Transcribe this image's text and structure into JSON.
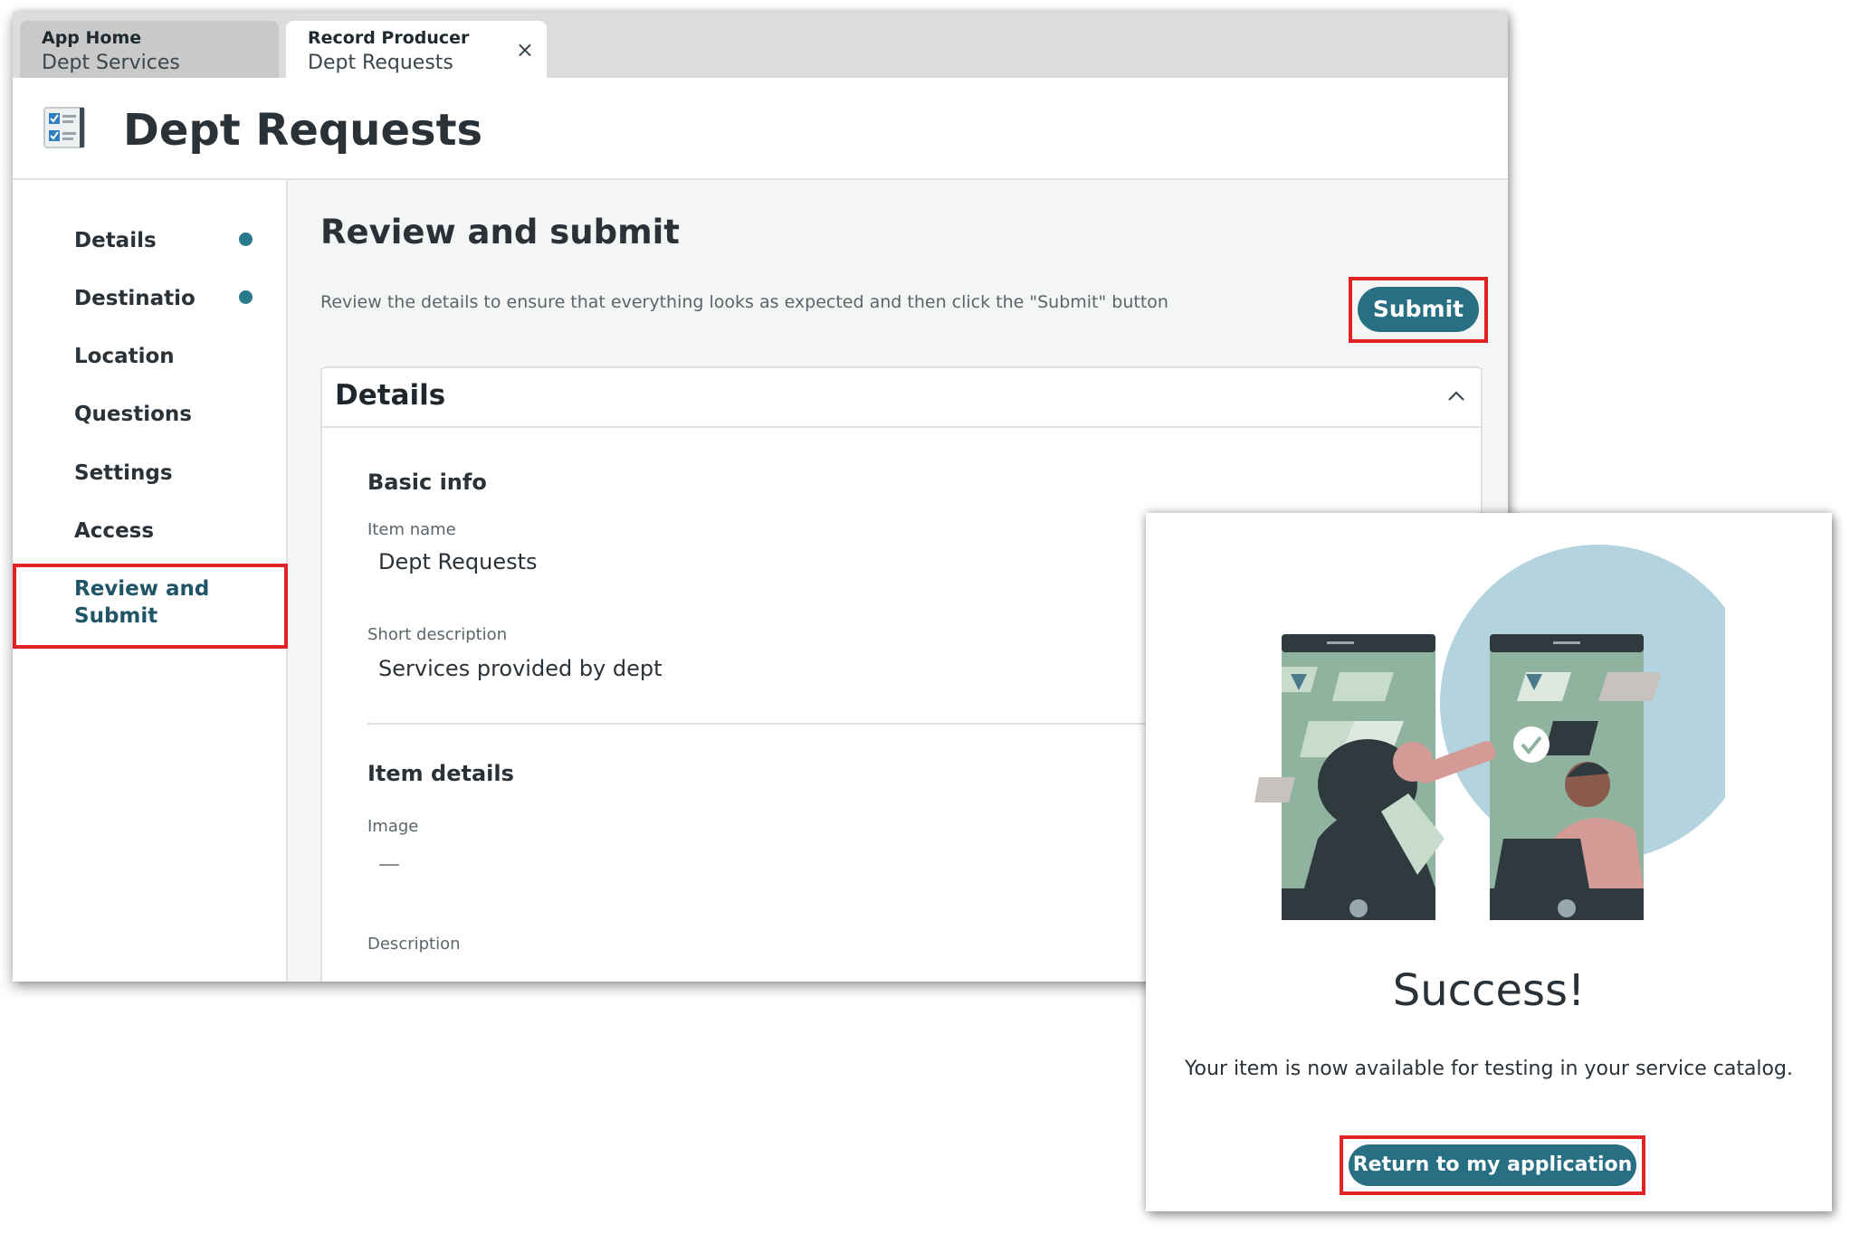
{
  "tabs": [
    {
      "small": "App Home",
      "big": "Dept Services"
    },
    {
      "small": "Record Producer",
      "big": "Dept Requests",
      "close": "×"
    }
  ],
  "header": {
    "title": "Dept Requests"
  },
  "sidebar": {
    "items": [
      {
        "label": "Details",
        "completed": true
      },
      {
        "label": "Destinatio",
        "completed": true
      },
      {
        "label": "Location"
      },
      {
        "label": "Questions"
      },
      {
        "label": "Settings"
      },
      {
        "label": "Access"
      },
      {
        "label": "Review and Submit",
        "active": true
      }
    ]
  },
  "main": {
    "title": "Review and submit",
    "subtitle": "Review the details to ensure that everything looks as expected and then click the \"Submit\" button",
    "submit_label": "Submit",
    "card": {
      "title": "Details",
      "basic_info": "Basic info",
      "item_name_label": "Item name",
      "item_name": "Dept Requests",
      "short_desc_label": "Short description",
      "short_desc": "Services provided by dept",
      "item_details": "Item details",
      "image_label": "Image",
      "image_value": "—",
      "description_label": "Description"
    }
  },
  "success": {
    "title": "Success!",
    "message": "Your item is now available for testing in your service catalog.",
    "button": "Return to my application"
  },
  "colors": {
    "accent": "#286f84",
    "highlight": "#e02424",
    "dot": "#2a7a8e"
  }
}
